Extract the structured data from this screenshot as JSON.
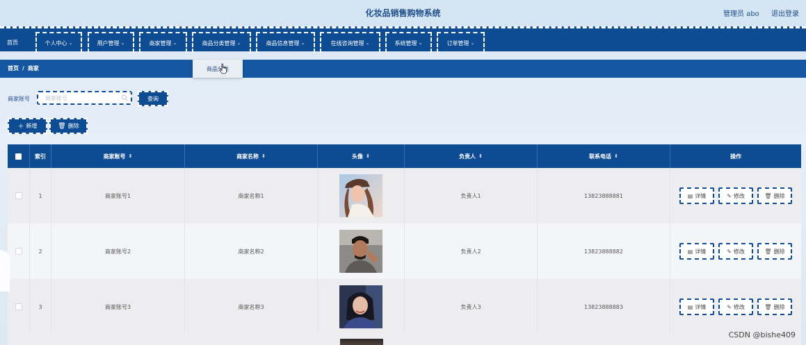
{
  "header": {
    "title": "化妆品销售购物系统",
    "user_label": "管理员 abo",
    "logout_label": "退出登录"
  },
  "nav": {
    "items": [
      {
        "label": "首页",
        "has_menu": false
      },
      {
        "label": "个人中心",
        "has_menu": true
      },
      {
        "label": "用户管理",
        "has_menu": true
      },
      {
        "label": "商家管理",
        "has_menu": true
      },
      {
        "label": "商品分类管理",
        "has_menu": true
      },
      {
        "label": "商品信息管理",
        "has_menu": true
      },
      {
        "label": "在线咨询管理",
        "has_menu": true
      },
      {
        "label": "系统管理",
        "has_menu": true
      },
      {
        "label": "订单管理",
        "has_menu": true
      }
    ],
    "chevron": "⌄",
    "dropdown_item": "商品分类"
  },
  "breadcrumb": {
    "home": "首页",
    "separator": "/",
    "current": "商家"
  },
  "search": {
    "label": "商家账号",
    "placeholder": "商家账号",
    "value": "",
    "query_label": "查询"
  },
  "toolbar": {
    "add_label": "新增",
    "delete_label": "删除"
  },
  "table": {
    "columns": [
      "",
      "索引",
      "商家账号",
      "商家名称",
      "头像",
      "负责人",
      "联系电话",
      "操作"
    ],
    "sortable": [
      false,
      false,
      true,
      true,
      true,
      true,
      true,
      false
    ],
    "actions": [
      "详情",
      "修改",
      "删除"
    ],
    "rows": [
      {
        "index": "1",
        "account": "商家账号1",
        "name": "商家名称1",
        "manager": "负责人1",
        "phone": "13823888881"
      },
      {
        "index": "2",
        "account": "商家账号2",
        "name": "商家名称2",
        "manager": "负责人2",
        "phone": "13823888882"
      },
      {
        "index": "3",
        "account": "商家账号3",
        "name": "商家名称3",
        "manager": "负责人3",
        "phone": "13823888883"
      }
    ]
  },
  "watermark": "CSDN @bishe409",
  "colors": {
    "primary": "#0d4b93",
    "breadcrumb": "#1457a0",
    "title": "#1f4f8a"
  }
}
